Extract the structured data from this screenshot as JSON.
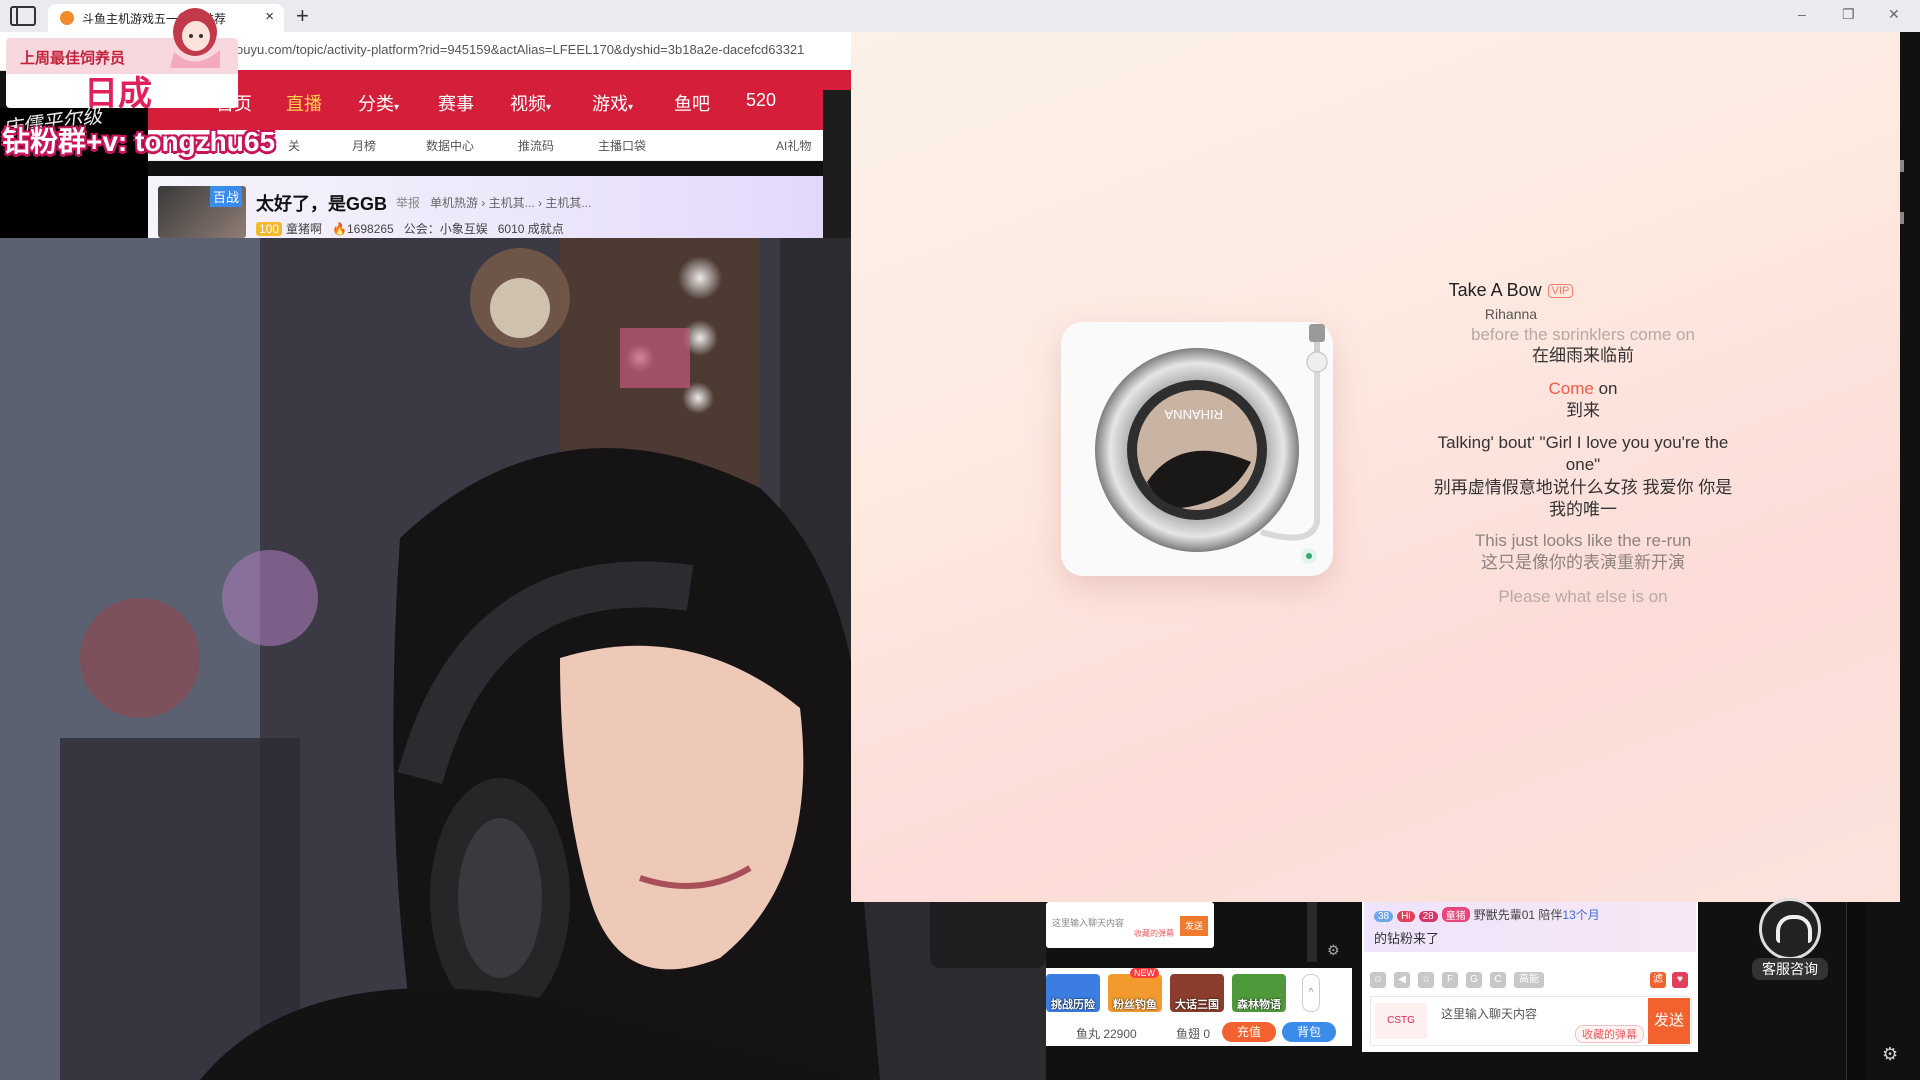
{
  "browser": {
    "tab_title": "斗鱼主机游戏五一热门推荐",
    "tab_close": "×",
    "new_tab": "+",
    "url": "ouyu.com/topic/activity-platform?rid=945159&actAlias=LFEEL170&dyshid=3b18a2e-dacefcd63321",
    "window_controls": [
      "–",
      "❐",
      "✕"
    ]
  },
  "douyu": {
    "nav": [
      "首页",
      "直播",
      "分类",
      "赛事",
      "视频",
      "游戏",
      "鱼吧",
      "520"
    ],
    "nav_active_index": 1,
    "subnav": [
      "关",
      "月榜",
      "数据中心",
      "推流码",
      "主播口袋",
      "AI礼物"
    ],
    "room": {
      "badge": "百战",
      "title": "太好了，是GGB",
      "report": "举报",
      "categories": "单机热游 › 主机其... › 主机其...",
      "streamer": "童猪啊",
      "heat": "1698265",
      "guild": "公会：小象互娱",
      "achievement": "6010 成就点",
      "level": "100"
    }
  },
  "overlay": {
    "caption": "上周最佳饲养员",
    "name": "日成",
    "script_text": "床儒平尔级",
    "fan_text": "钻粉群+v: tongzhu65"
  },
  "music": {
    "title": "Take A Bow",
    "vip": "VIP",
    "artist": "Rihanna",
    "album_text": "RIHANNA",
    "lyrics": {
      "l0": "before the sprinklers come on",
      "l1": "在细雨来临前",
      "l2_hl": "Come",
      "l2_rest": " on",
      "l3": "到来",
      "l4": "Talking' bout' \"Girl I love you you're the one\"",
      "l5": "别再虚情假意地说什么女孩 我爱你 你是我的唯一",
      "l6": "This just looks like the re-run",
      "l7": "这只是像你的表演重新开演",
      "l8": "Please what else is on"
    },
    "colors": {
      "accent": "#ee5b48",
      "bg_top": "#fbf1e9",
      "bg_bottom": "#fcdcd8"
    }
  },
  "bottom": {
    "mini_chat": {
      "placeholder": "这里输入聊天内容",
      "send": "发送",
      "barrage": "收藏的弹幕"
    },
    "games": [
      {
        "label": "挑战历险",
        "color": "#3b7de0"
      },
      {
        "label": "粉丝钓鱼",
        "color": "#f29a2e"
      },
      {
        "label": "大话三国",
        "color": "#8a3d2a"
      },
      {
        "label": "森林物语",
        "color": "#4e9a3a"
      }
    ],
    "new_badge": "NEW",
    "expand": "^",
    "wallet": {
      "yuwan": "鱼丸 22900",
      "yuchi": "鱼翅 0",
      "recharge": "充值",
      "bag": "背包"
    },
    "chat_message": {
      "level1": "38",
      "hi": "Hi",
      "level2": "28",
      "medal": "童猪",
      "user": "野獣先輩01",
      "text_pre": " 陪伴",
      "months": "13个月",
      "line2": "的钻粉来了"
    },
    "chat_tools_extra": "高能",
    "chat_input": {
      "avatar": "CSTG",
      "placeholder": "这里输入聊天内容",
      "barrage": "收藏的弹幕",
      "send": "发送"
    },
    "customer_service": "客服咨询"
  }
}
